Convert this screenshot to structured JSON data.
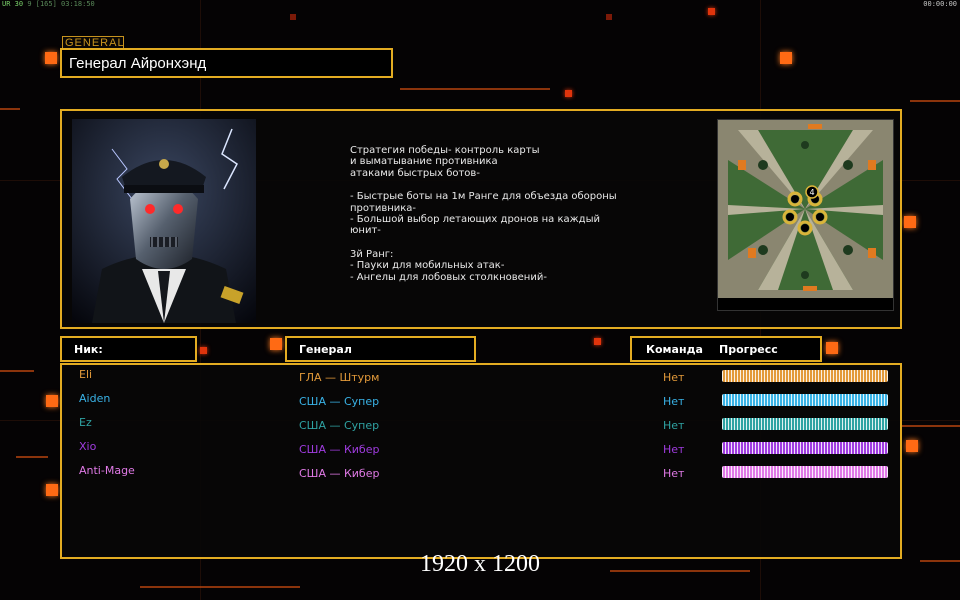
{
  "topbar": {
    "left_prefix": "UR",
    "left_mid": "30",
    "left_rest": "9 [165] 03:18:50",
    "right": "00:00:00"
  },
  "general": {
    "tag": "GENERAL",
    "name": "Генерал Айронхэнд"
  },
  "description": {
    "lines": [
      "Стратегия победы- контроль карты",
      "и выматывание противника",
      "атаками быстрых ботов-",
      "",
      "- Быстрые боты на 1м Ранге для объезда обороны",
      " противника-",
      "- Большой выбор летающих дронов на каждый",
      " юнит-",
      "",
      "3й Ранг:",
      "- Пауки для мобильных атак-",
      "- Ангелы для лобовых столкновений-"
    ]
  },
  "minimap": {
    "center_label": "4"
  },
  "headers": {
    "nick": "Ник:",
    "general": "Генерал",
    "team": "Команда",
    "progress": "Прогресс"
  },
  "players": [
    {
      "nick": "Eli",
      "general": "ГЛА — Штурм",
      "team": "Нет",
      "color": "#e39a3a",
      "progress": 1.0
    },
    {
      "nick": "Aiden",
      "general": "США — Супер",
      "team": "Нет",
      "color": "#39b2e6",
      "progress": 1.0
    },
    {
      "nick": "Ez",
      "general": "США — Супер",
      "team": "Нет",
      "color": "#2fa3a3",
      "progress": 1.0
    },
    {
      "nick": "Xio",
      "general": "США — Кибер",
      "team": "Нет",
      "color": "#a03ce0",
      "progress": 1.0
    },
    {
      "nick": "Anti-Mage",
      "general": "США — Кибер",
      "team": "Нет",
      "color": "#e07ae6",
      "progress": 1.0
    }
  ],
  "resolution": "1920 x 1200",
  "colors": {
    "accent": "#e3ac22",
    "orange": "#ff6a14"
  }
}
